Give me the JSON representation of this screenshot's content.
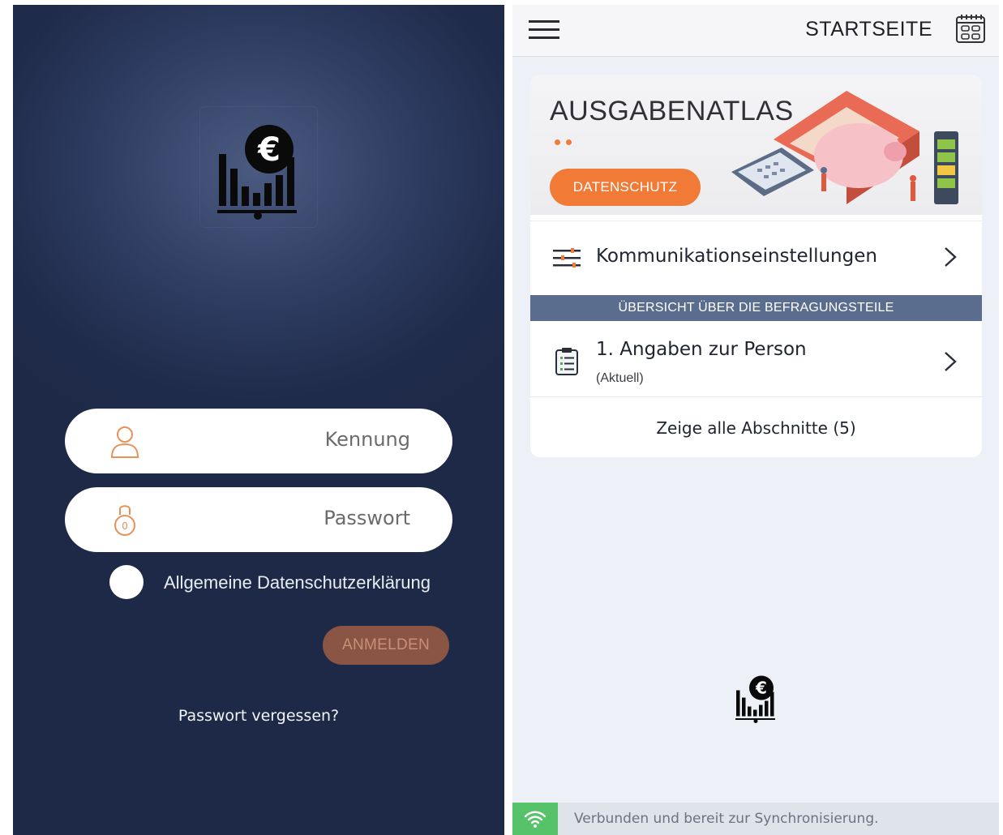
{
  "login": {
    "username_label": "Kennung",
    "password_label": "Passwort",
    "privacy_label": "Allgemeine Datenschutzerklärung",
    "login_button": "ANMELDEN",
    "forgot_link": "Passwort vergessen?",
    "icons": {
      "logo": "euro-chart-logo-icon",
      "username": "user-icon",
      "password": "lock-icon"
    }
  },
  "home": {
    "title": "STARTSEITE",
    "app_name": "AUSGABENATLAS",
    "privacy_button": "DATENSCHUTZ",
    "communication_settings": "Kommunikationseinstellungen",
    "section_header": "ÜBERSICHT ÜBER DIE BEFRAGUNGSTEILE",
    "sections": [
      {
        "title": "1. Angaben zur Person",
        "status": "(Aktuell)"
      }
    ],
    "show_all": "Zeige alle Abschnitte (5)",
    "status_text": "Verbunden und bereit zur Synchronisierung.",
    "icons": {
      "menu": "hamburger-menu-icon",
      "calendar": "calendar-icon",
      "settings": "sliders-icon",
      "section": "clipboard-icon",
      "sync": "wifi-icon"
    }
  },
  "colors": {
    "login_bg": "#1f2b4a",
    "accent_orange": "#f27a37",
    "login_button_bg": "#8a5544",
    "section_header_bg": "#5a6d8e",
    "status_green": "#56c26a"
  }
}
